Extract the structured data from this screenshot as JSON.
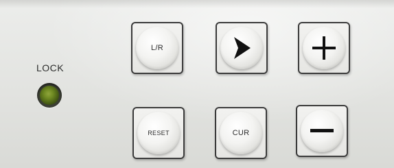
{
  "indicator": {
    "label": "LOCK",
    "led_color": "#6f8a22"
  },
  "buttons": {
    "lr": {
      "label": "L/R"
    },
    "play": {
      "icon": "play-arrow-icon"
    },
    "plus": {
      "icon": "plus-icon"
    },
    "reset": {
      "label": "RESET"
    },
    "cur": {
      "label": "CUR"
    },
    "minus": {
      "icon": "minus-icon"
    }
  },
  "colors": {
    "panel": "#e4e5e2",
    "button_border": "#3a3a3a",
    "glyph": "#111111"
  }
}
